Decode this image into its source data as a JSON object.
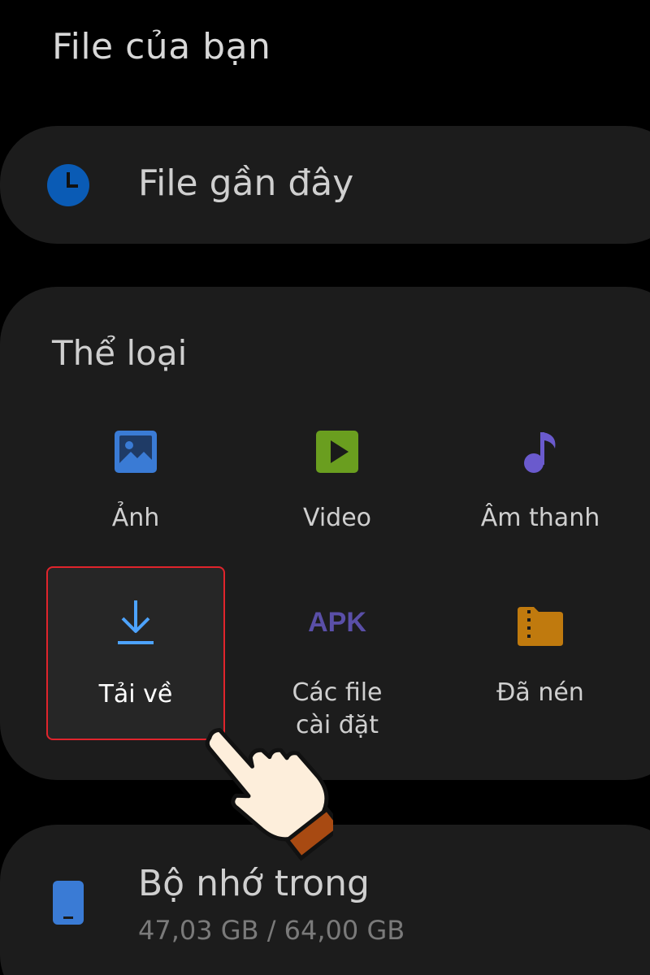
{
  "header": {
    "title": "File của bạn"
  },
  "recent": {
    "label": "File gần đây",
    "icon": "clock-icon",
    "accent": "#0a5bb5"
  },
  "categories": {
    "title": "Thể loại",
    "items": [
      {
        "label": "Ảnh",
        "icon": "image-icon",
        "color": "#3a7bd5"
      },
      {
        "label": "Video",
        "icon": "video-play-icon",
        "color": "#6a9e1f"
      },
      {
        "label": "Âm thanh",
        "icon": "music-note-icon",
        "color": "#6a5acd"
      },
      {
        "label": "Tải về",
        "icon": "download-icon",
        "color": "#4da3ff",
        "selected": true
      },
      {
        "label_line1": "Các file",
        "label_line2": "cài đặt",
        "icon": "apk-icon",
        "icon_text": "APK",
        "color": "#5a4fa8"
      },
      {
        "label": "Đã nén",
        "icon": "folder-zip-icon",
        "color": "#c07a0e"
      }
    ]
  },
  "storage": {
    "title": "Bộ nhớ trong",
    "usage": "47,03 GB / 64,00 GB",
    "icon": "phone-storage-icon",
    "color": "#3a7bd5"
  },
  "overlay": {
    "icon": "pointing-hand-icon",
    "highlight_color": "#e0242c"
  }
}
